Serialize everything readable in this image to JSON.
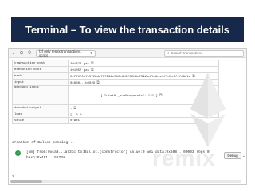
{
  "slide": {
    "title": "Terminal – To view the transaction details"
  },
  "toolbar": {
    "collapse_icon": "chevron-down-icon",
    "clear_icon": "clear-icon",
    "pending_count": "0",
    "scope_label": "[2] only remix transactions, script",
    "search_placeholder": "Search transactions"
  },
  "tx_rows": [
    {
      "key": "transaction cost",
      "value": "291877 gas"
    },
    {
      "key": "execution cost",
      "value": "191057 gas"
    },
    {
      "key": "hash",
      "value": "0x7f0f0b7c572b4e707962c515c6d5f02b6c7592adfb6b1e0f7d7e5f1fd8e1a"
    },
    {
      "key": "input",
      "value": "0x608...b0029"
    },
    {
      "key": "decoded input",
      "value": "{ \"uint8 _numProposals\": \"4\" }"
    },
    {
      "key": "decoded output",
      "value": "-"
    },
    {
      "key": "logs",
      "value": "[] ⊙ ⊙"
    },
    {
      "key": "value",
      "value": "0 wei"
    }
  ],
  "watermark": "remix",
  "log": {
    "pending": "creation of Ballot pending...",
    "line1": "[vm] from:0xca3...a733c to:Ballot.(constructor) value:0 wei data:0x608...00003 logs:0",
    "line2": "hash:0x491...5273a",
    "debug_label": "Debug"
  },
  "prompt": ">"
}
